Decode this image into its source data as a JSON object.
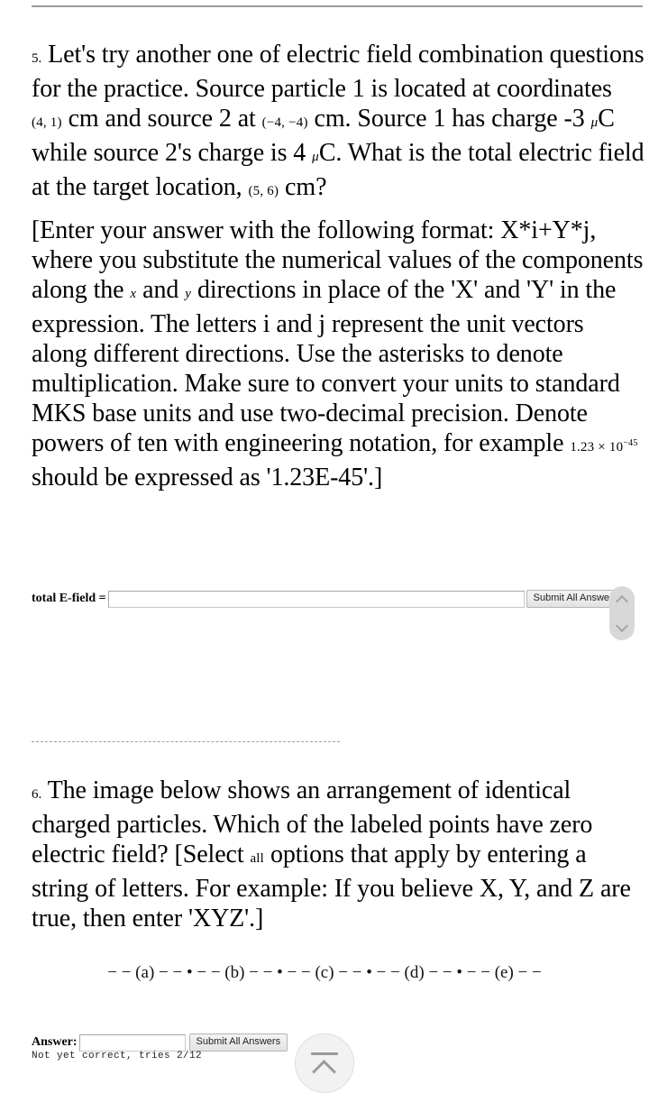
{
  "problems": [
    {
      "number": "5.",
      "paragraphs": [
        {
          "segments": [
            {
              "kind": "text",
              "value": "Let's try another one of electric field combination questions for the practice. Source particle 1 is located at coordinates "
            },
            {
              "kind": "math",
              "value": "(4, 1)"
            },
            {
              "kind": "text",
              "value": " cm and source 2 at "
            },
            {
              "kind": "math",
              "value": "(−4, −4)"
            },
            {
              "kind": "text",
              "value": " cm. Source 1 has charge -3 "
            },
            {
              "kind": "math-italic",
              "value": "μ"
            },
            {
              "kind": "text",
              "value": "C while source 2's charge is 4 "
            },
            {
              "kind": "math-italic",
              "value": "μ"
            },
            {
              "kind": "text",
              "value": "C. What is the total electric field at the target location, "
            },
            {
              "kind": "math",
              "value": "(5, 6)"
            },
            {
              "kind": "text",
              "value": " cm?"
            }
          ]
        },
        {
          "segments": [
            {
              "kind": "text",
              "value": "[Enter your answer with the following format: X*i+Y*j, where you substitute the numerical values of the components along the "
            },
            {
              "kind": "math-italic",
              "value": "x"
            },
            {
              "kind": "text",
              "value": " and "
            },
            {
              "kind": "math-italic",
              "value": "y"
            },
            {
              "kind": "text",
              "value": " directions in place of the 'X' and 'Y' in the expression. The letters i and j represent the unit vectors along different directions. Use the asterisks to denote multiplication. Make sure to convert your units to standard MKS base units and use two-decimal precision. Denote powers of ten with engineering notation, for example "
            },
            {
              "kind": "math-power",
              "mantissa": "1.23",
              "times": "×",
              "base": "10",
              "exponent": "−45"
            },
            {
              "kind": "text",
              "value": " should be expressed as '1.23E-45'.]"
            }
          ]
        }
      ],
      "answer": {
        "label": "total E-field =",
        "value": "",
        "placeholder": "",
        "submit_label": "Submit All Answers",
        "status": ""
      }
    },
    {
      "number": "6.",
      "paragraphs": [
        {
          "segments": [
            {
              "kind": "text",
              "value": "The image below shows an arrangement of identical charged particles. Which of the labeled points have zero electric field? [Select "
            },
            {
              "kind": "math",
              "value": "all"
            },
            {
              "kind": "text",
              "value": " options that apply by entering a string of letters. For example: If you believe X, Y, and Z are true, then enter 'XYZ'.]"
            }
          ]
        }
      ],
      "diagram": "− − (a) − − • − − (b) − − • − − (c) − − • − − (d) − − • − − (e) − −",
      "answer": {
        "label": "Answer:",
        "value": "",
        "placeholder": "",
        "submit_label": "Submit All Answers",
        "status": "Not yet correct, tries 2/12"
      }
    }
  ],
  "widgets": {
    "scroll_pill": {
      "up_icon": "chevron-up-icon",
      "down_icon": "chevron-down-icon"
    },
    "scroll_to_top": {
      "icon": "jump-to-top-icon"
    }
  },
  "colors": {
    "text": "#000000",
    "rule": "#9a9a9a",
    "divider": "#9d9d9d",
    "button_face": "#e9e9e9",
    "widget_gray": "#d8d8d8"
  }
}
